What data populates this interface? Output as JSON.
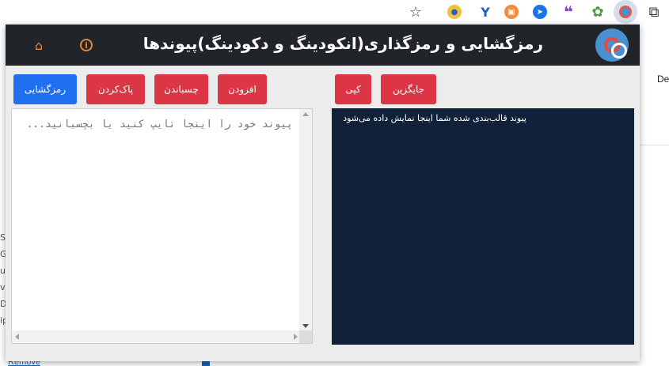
{
  "popup": {
    "title": "رمزگشایی و رمزگذاری(انکودینگ و دکودینگ)پیوندها",
    "home_icon": "home-icon",
    "info_icon": "info-icon",
    "logo_icon": "link-logo-icon"
  },
  "buttons": {
    "decode": "رمزگشایی",
    "clear": "پاک‌کردن",
    "paste": "چسباندن",
    "add": "افزودن",
    "copy": "کپی",
    "replace": "جایگزین"
  },
  "input": {
    "placeholder": "پیوند خود را اینجا تایپ کنید یا بچسبانید...",
    "value": ""
  },
  "output": {
    "text": "پیوند قالب‌بندی شده شما اینجا نمایش داده می‌شود"
  },
  "background_page": {
    "right_text": "De",
    "bottom_link": "Remove",
    "left_text": "Si G ul vi D ip"
  },
  "colors": {
    "header_bg": "#21252a",
    "button_red": "#dc3545",
    "button_blue": "#1f6ff0",
    "output_bg": "#11213a",
    "icon_orange": "#e8833a"
  }
}
